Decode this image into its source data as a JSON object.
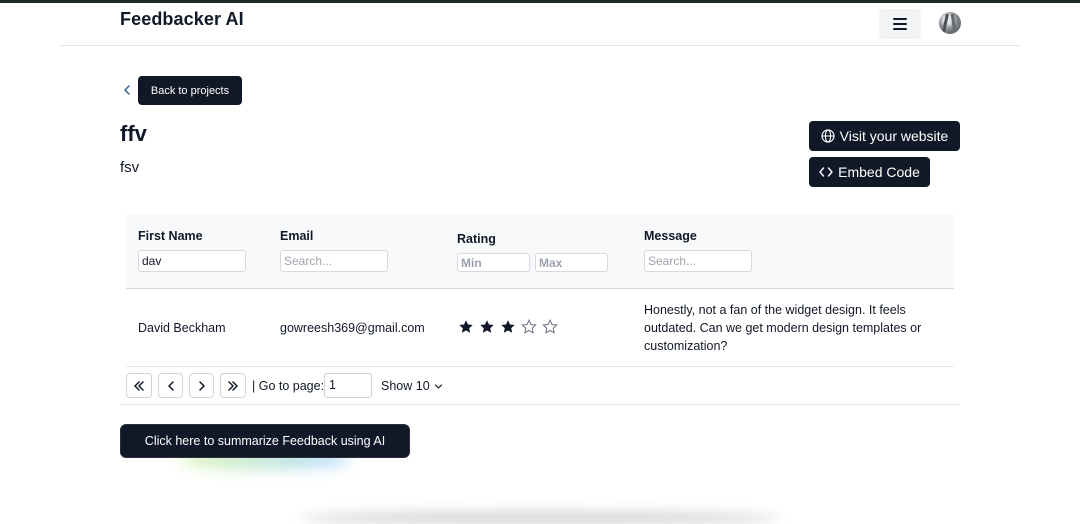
{
  "header": {
    "brand": "Feedbacker AI",
    "menu_icon": "hamburger-icon",
    "avatar_icon": "user-avatar"
  },
  "project": {
    "back_label": "Back to projects",
    "name": "ffv",
    "description": "fsv",
    "visit_label": "Visit your website",
    "embed_label": "Embed Code"
  },
  "table": {
    "columns": {
      "first_name": "First Name",
      "email": "Email",
      "rating": "Rating",
      "message": "Message"
    },
    "filters": {
      "first_name_value": "dav",
      "email_placeholder": "Search...",
      "rating_min_placeholder": "Min",
      "rating_max_placeholder": "Max",
      "message_placeholder": "Search..."
    },
    "rows": [
      {
        "first_name": "David Beckham",
        "email": "gowreesh369@gmail.com",
        "rating": 3,
        "rating_max": 5,
        "message": "Honestly, not a fan of the widget design. It feels outdated. Can we get modern design templates or customization?"
      }
    ]
  },
  "pagination": {
    "goto_label": "| Go to page:",
    "page_value": "1",
    "show_label": "Show 10"
  },
  "summarize_label": "Click here to summarize Feedback using AI",
  "colors": {
    "primary": "#111827",
    "header_bg": "#f8f9fa",
    "border": "#d6d9de"
  }
}
